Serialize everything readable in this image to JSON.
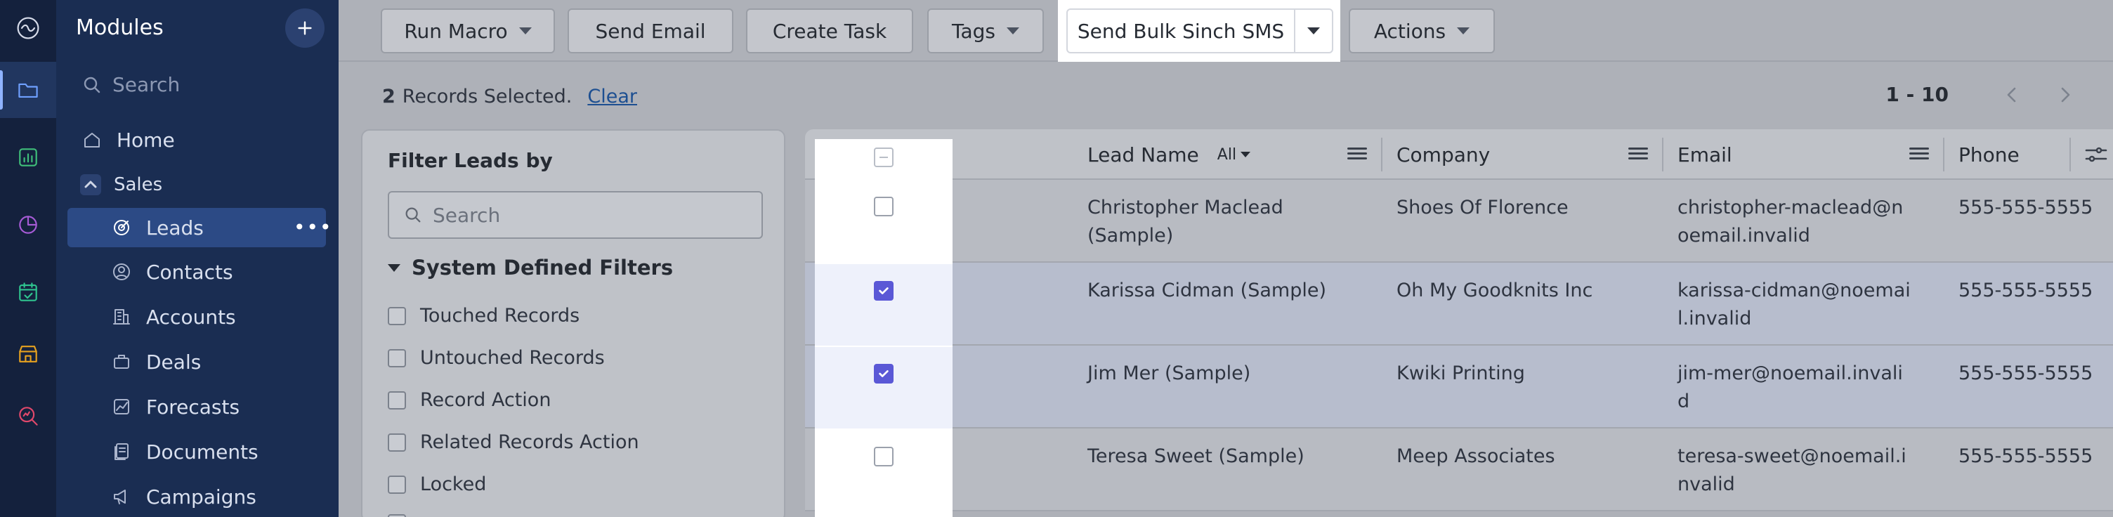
{
  "rail": {
    "items": [
      {
        "icon": "zoho-logo-icon"
      },
      {
        "icon": "folder-icon",
        "active": true
      },
      {
        "icon": "analytics-icon"
      },
      {
        "icon": "pie-chart-icon"
      },
      {
        "icon": "calendar-check-icon"
      },
      {
        "icon": "store-icon"
      },
      {
        "icon": "search-analytics-icon"
      }
    ]
  },
  "sidebar": {
    "title": "Modules",
    "search_placeholder": "Search",
    "home": "Home",
    "sales": "Sales",
    "items": [
      {
        "label": "Leads",
        "icon": "leads-icon"
      },
      {
        "label": "Contacts",
        "icon": "contacts-icon"
      },
      {
        "label": "Accounts",
        "icon": "accounts-icon"
      },
      {
        "label": "Deals",
        "icon": "deals-icon"
      },
      {
        "label": "Forecasts",
        "icon": "forecasts-icon"
      },
      {
        "label": "Documents",
        "icon": "documents-icon"
      },
      {
        "label": "Campaigns",
        "icon": "campaigns-icon"
      }
    ]
  },
  "toolbar": {
    "run_macro": "Run Macro",
    "send_email": "Send Email",
    "create_task": "Create Task",
    "tags": "Tags",
    "send_bulk_sms": "Send Bulk Sinch SMS",
    "actions": "Actions"
  },
  "selection": {
    "count": "2",
    "text": "Records Selected.",
    "clear": "Clear"
  },
  "pager": {
    "range": "1 - 10"
  },
  "filter": {
    "title": "Filter Leads by",
    "search_placeholder": "Search",
    "section": "System Defined Filters",
    "options": [
      "Touched Records",
      "Untouched Records",
      "Record Action",
      "Related Records Action",
      "Locked"
    ]
  },
  "table": {
    "columns": {
      "lead_name": "Lead Name",
      "lead_name_filter": "All",
      "company": "Company",
      "email": "Email",
      "phone": "Phone"
    },
    "rows": [
      {
        "name1": "Christopher Maclead",
        "name2": "(Sample)",
        "company": "Shoes Of Florence",
        "email": "christopher-maclead@noemail.invalid",
        "phone": "555-555-5555",
        "selected": false
      },
      {
        "name1": "Karissa Cidman (Sample)",
        "name2": "",
        "company": "Oh My Goodknits Inc",
        "email": "karissa-cidman@noemail.invalid",
        "phone": "555-555-5555",
        "selected": true
      },
      {
        "name1": "Jim Mer (Sample)",
        "name2": "",
        "company": "Kwiki Printing",
        "email": "jim-mer@noemail.invalid",
        "phone": "555-555-5555",
        "selected": true
      },
      {
        "name1": "Teresa Sweet (Sample)",
        "name2": "",
        "company": "Meep Associates",
        "email": "teresa-sweet@noemail.invalid",
        "phone": "555-555-5555",
        "selected": false
      }
    ]
  }
}
